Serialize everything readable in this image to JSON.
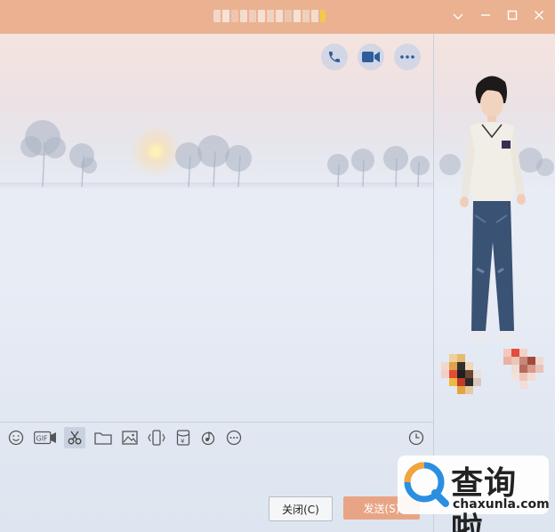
{
  "window": {
    "controls": {
      "dropdown": "chevron-down-icon",
      "minimize": "minimize-icon",
      "maximize": "maximize-icon",
      "close": "close-icon"
    }
  },
  "chat_header": {
    "buttons": [
      "phone-icon",
      "video-icon",
      "more-icon"
    ]
  },
  "toolbar": {
    "left": [
      "emoji-icon",
      "gif-icon",
      "scissors-icon",
      "folder-icon",
      "image-icon",
      "shake-icon",
      "red-packet-icon",
      "music-icon",
      "more-icon"
    ],
    "right": [
      "history-clock-icon"
    ],
    "gif_text": "GIF",
    "redpacket_text": "¥"
  },
  "footer": {
    "close_label": "关闭(C)",
    "send_label": "发送(S)"
  },
  "watermark": {
    "brand_cn": "查询啦",
    "brand_en": "chaxunla.com"
  },
  "colors": {
    "titlebar": "#eab290",
    "send_button": "#e8a585",
    "icon_blue": "#2e5d9c"
  }
}
